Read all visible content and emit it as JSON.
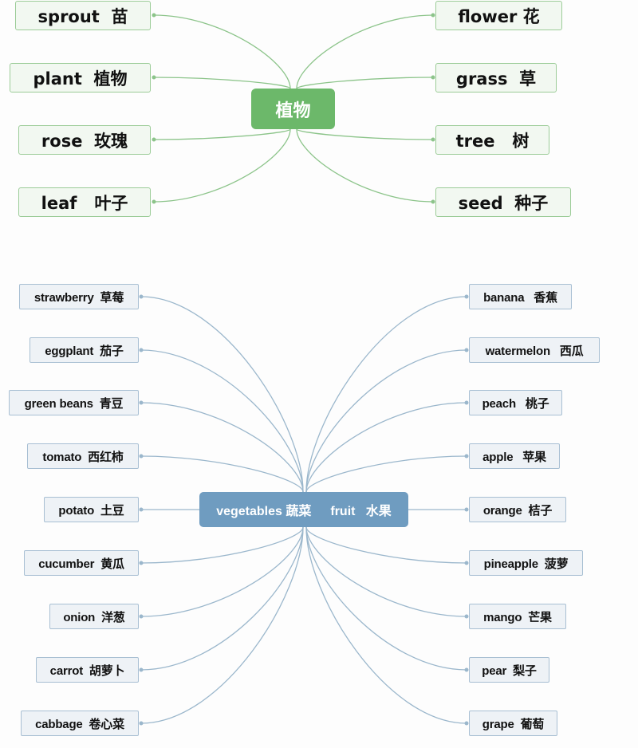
{
  "colors": {
    "green_center": "#6cb86a",
    "green_line": "#8cc48a",
    "blue_center": "#6f9cc0",
    "blue_line": "#9bb7cc"
  },
  "plants_map": {
    "center": "植物",
    "left": [
      "sprout  苗",
      "plant  植物",
      "rose  玫瑰",
      "leaf   叶子"
    ],
    "right": [
      "flower 花",
      "grass  草",
      "tree   树",
      "seed  种子"
    ]
  },
  "produce_map": {
    "center_left": "vegetables 蔬菜",
    "center_right": "fruit   水果",
    "vegetables": [
      "strawberry  草莓",
      "eggplant  茄子",
      "green beans  青豆",
      "tomato  西红柿",
      "potato  土豆",
      "cucumber  黄瓜",
      "onion  洋葱",
      "carrot  胡萝卜",
      "cabbage  卷心菜"
    ],
    "fruits": [
      "banana   香蕉",
      "watermelon   西瓜",
      "peach   桃子",
      "apple   苹果",
      "orange  桔子",
      "pineapple  菠萝",
      "mango  芒果",
      "pear  梨子",
      "grape  葡萄"
    ]
  }
}
